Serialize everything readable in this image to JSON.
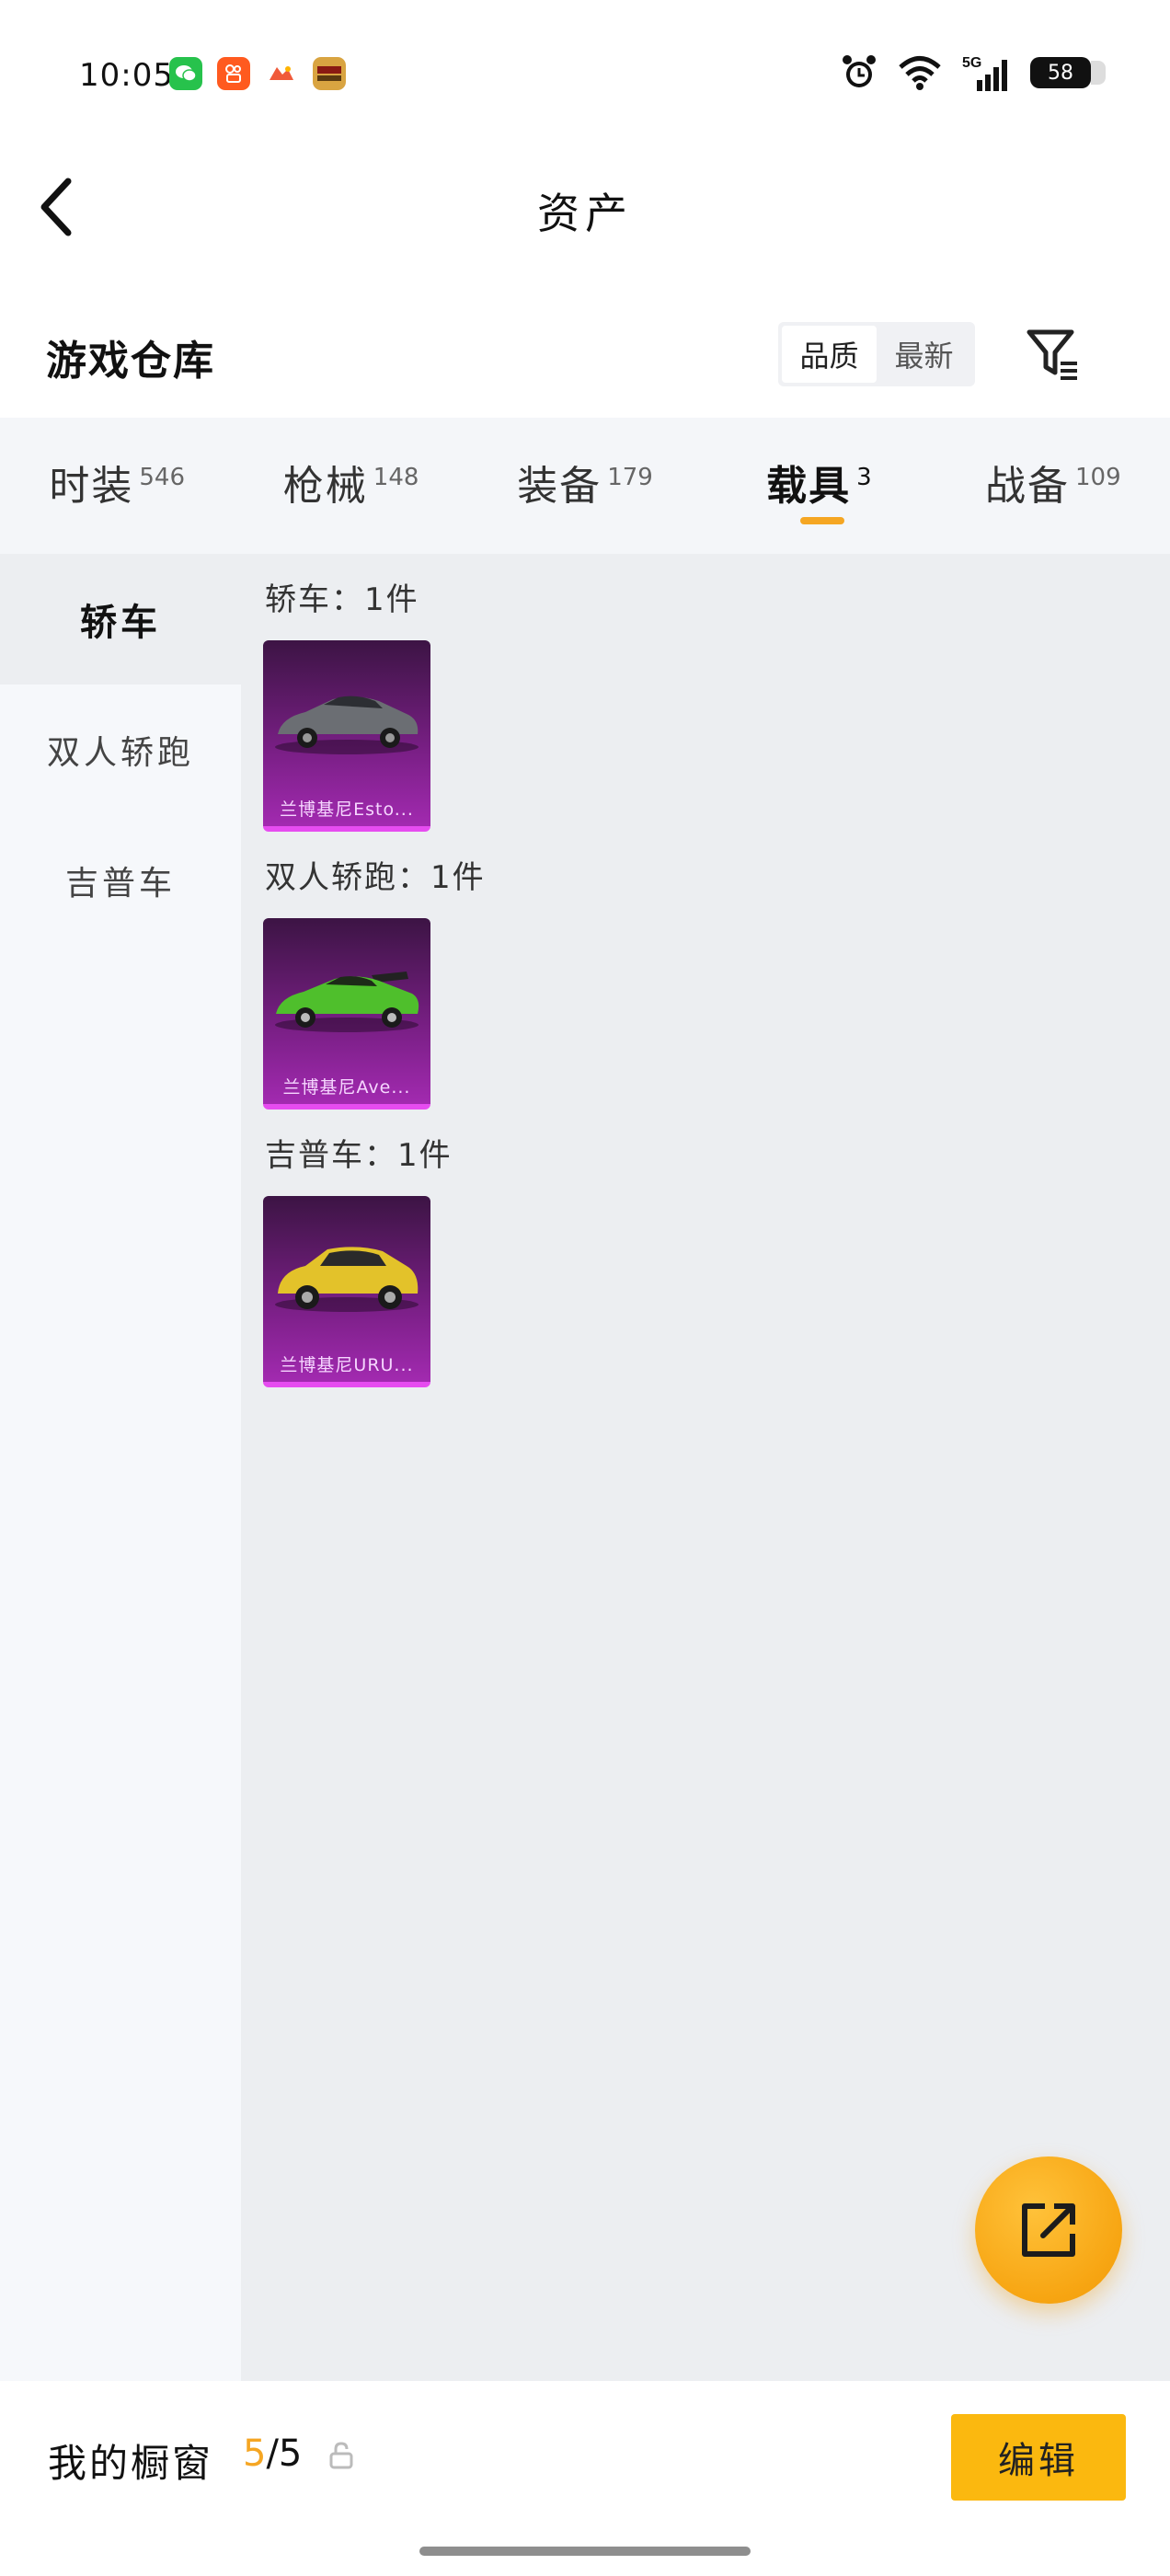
{
  "status_bar": {
    "time": "10:05",
    "apps": [
      "wechat-icon",
      "kuaishou-icon",
      "game-icon",
      "heping-jingying-icon"
    ],
    "network": "5G",
    "battery": "58"
  },
  "nav": {
    "title": "资产"
  },
  "warehouse": {
    "title": "游戏仓库",
    "sort_options": [
      "品质",
      "最新"
    ],
    "sort_active": "品质"
  },
  "tabs": [
    {
      "label": "时装",
      "count": "546"
    },
    {
      "label": "枪械",
      "count": "148"
    },
    {
      "label": "装备",
      "count": "179"
    },
    {
      "label": "载具",
      "count": "3",
      "active": true
    },
    {
      "label": "战备",
      "count": "109"
    }
  ],
  "sidebar": {
    "items": [
      {
        "label": "轿车",
        "active": true
      },
      {
        "label": "双人轿跑"
      },
      {
        "label": "吉普车"
      }
    ]
  },
  "groups": [
    {
      "label": "轿车：1件",
      "items": [
        {
          "name": "兰博基尼Esto...",
          "color": "#6b6e73"
        }
      ]
    },
    {
      "label": "双人轿跑：1件",
      "items": [
        {
          "name": "兰博基尼Ave...",
          "color": "#4fbf2c"
        }
      ]
    },
    {
      "label": "吉普车：1件",
      "items": [
        {
          "name": "兰博基尼URU...",
          "color": "#e3c22a"
        }
      ]
    }
  ],
  "bottom": {
    "showcase_label": "我的橱窗",
    "showcase_used": "5",
    "showcase_total": "/5",
    "edit_label": "编辑"
  },
  "colors": {
    "accent": "#f5a623",
    "card_top": "#3c1444",
    "card_bottom": "#a22ab0"
  }
}
